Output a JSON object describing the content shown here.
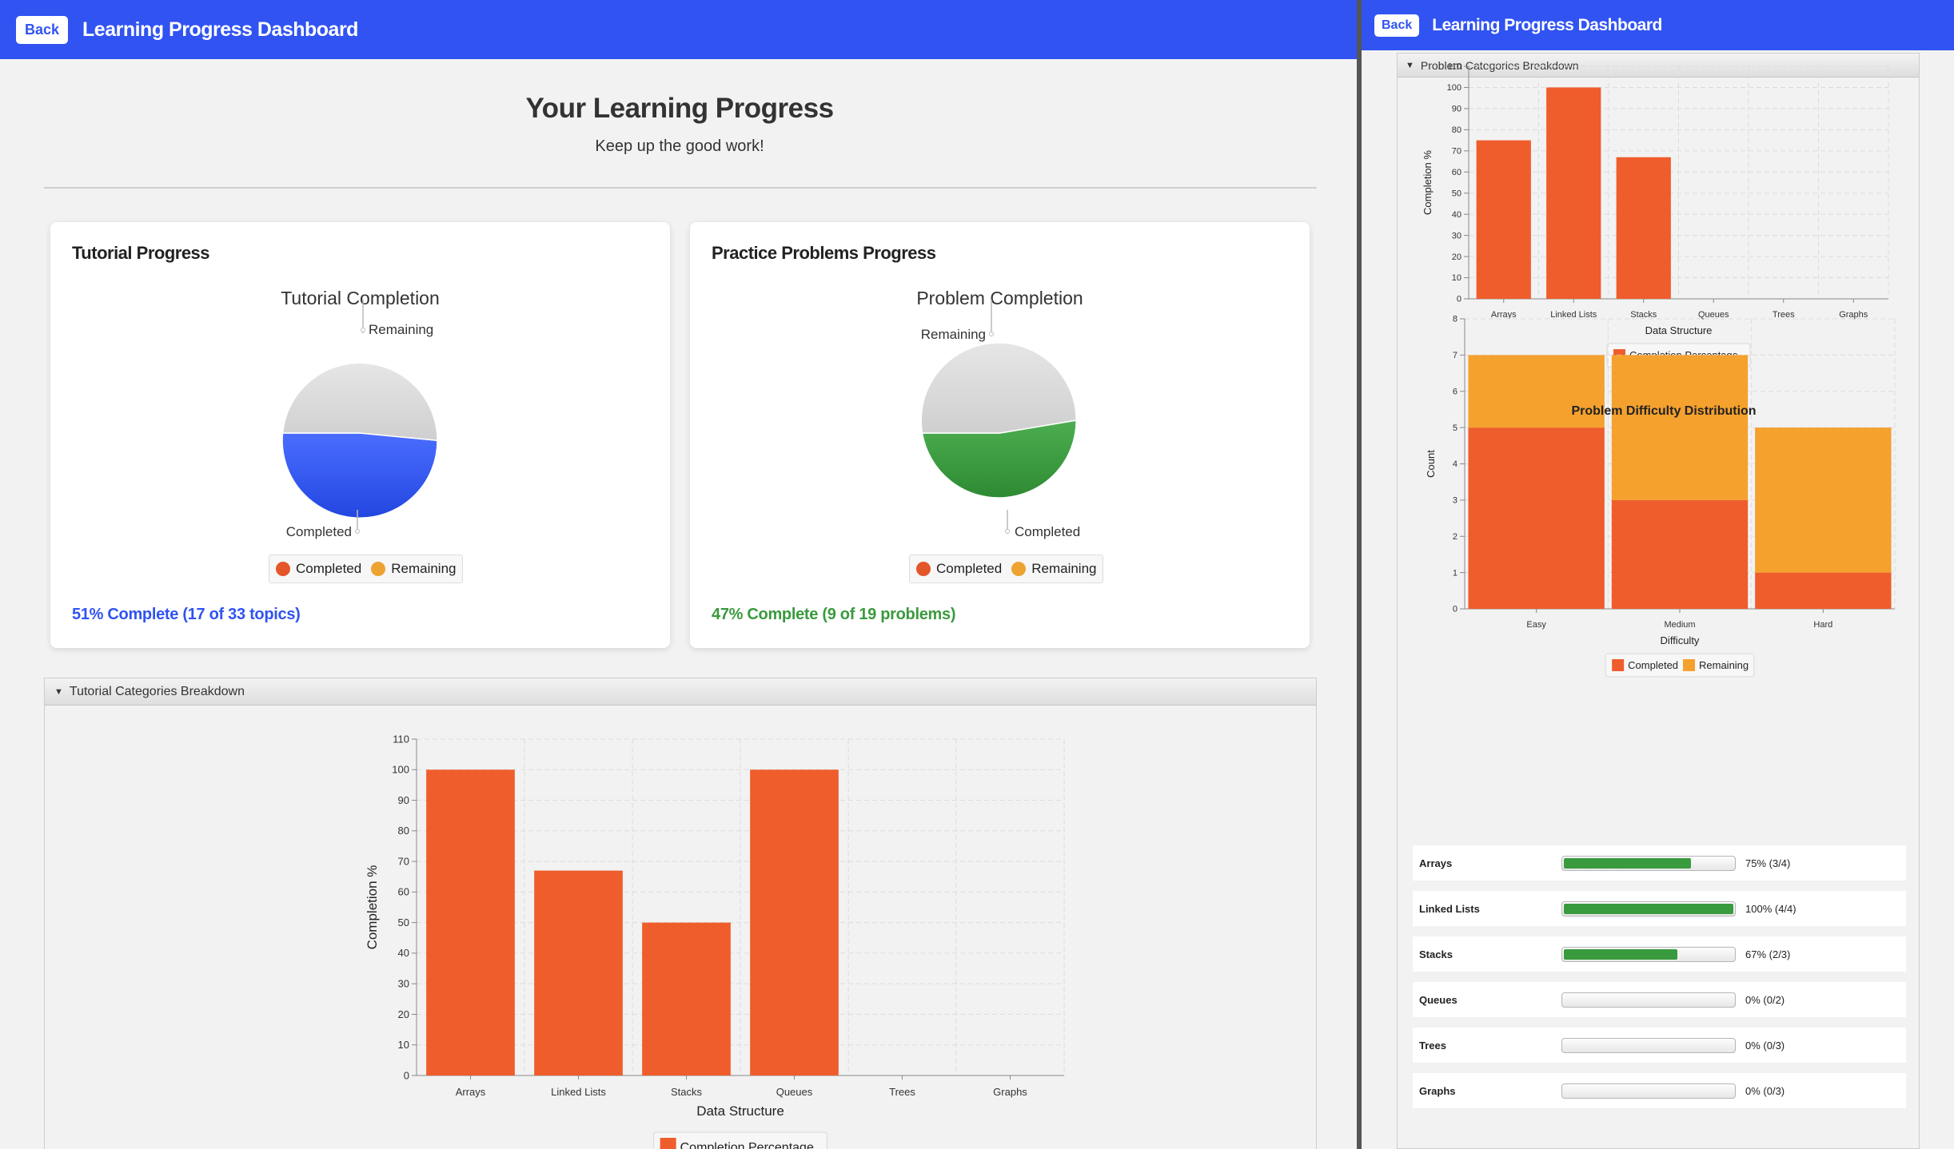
{
  "left_window": {
    "header": {
      "back_label": "Back",
      "title": "Learning Progress Dashboard"
    },
    "page_title": "Your Learning Progress",
    "page_subtitle": "Keep up the good work!",
    "tutorial_card": {
      "title": "Tutorial Progress",
      "pie_title": "Tutorial Completion",
      "label_completed": "Completed",
      "label_remaining": "Remaining",
      "legend": [
        "Completed",
        "Remaining"
      ],
      "summary": "51% Complete (17 of 33 topics)"
    },
    "problems_card": {
      "title": "Practice Problems Progress",
      "pie_title": "Problem Completion",
      "label_completed": "Completed",
      "label_remaining": "Remaining",
      "legend": [
        "Completed",
        "Remaining"
      ],
      "summary": "47% Complete (9 of 19 problems)"
    },
    "tutorial_pane": {
      "title": "Tutorial Categories Breakdown"
    }
  },
  "right_window": {
    "header": {
      "back_label": "Back",
      "title": "Learning Progress Dashboard"
    },
    "problems_pane": {
      "title": "Problem Categories Breakdown"
    },
    "progress_rows": [
      {
        "label": "Arrays",
        "fraction": 0.75,
        "text": "75% (3/4)"
      },
      {
        "label": "Linked Lists",
        "fraction": 1.0,
        "text": "100% (4/4)"
      },
      {
        "label": "Stacks",
        "fraction": 0.67,
        "text": "67% (2/3)"
      },
      {
        "label": "Queues",
        "fraction": 0.0,
        "text": "0% (0/2)"
      },
      {
        "label": "Trees",
        "fraction": 0.0,
        "text": "0% (0/3)"
      },
      {
        "label": "Graphs",
        "fraction": 0.0,
        "text": "0% (0/3)"
      }
    ]
  },
  "colors": {
    "header": "#3053f2",
    "tutorial_completed": "#3053f2",
    "problem_completed": "#3a9a3e",
    "remaining": "#d6d6d6",
    "bar": "#ef5d2c",
    "bar_remaining": "#f5a12e",
    "legend_completed_dot": "#e4552a",
    "legend_remaining_dot": "#eea232",
    "tutorial_text": "#3053f2",
    "problem_text": "#3a9a3e"
  },
  "chart_data": [
    {
      "id": "tutorial_pie",
      "type": "pie",
      "title": "Tutorial Completion",
      "labels": [
        "Completed",
        "Remaining"
      ],
      "values": [
        17,
        16
      ]
    },
    {
      "id": "problem_pie",
      "type": "pie",
      "title": "Problem Completion",
      "labels": [
        "Completed",
        "Remaining"
      ],
      "values": [
        9,
        10
      ]
    },
    {
      "id": "tutorial_bar",
      "type": "bar",
      "categories": [
        "Arrays",
        "Linked Lists",
        "Stacks",
        "Queues",
        "Trees",
        "Graphs"
      ],
      "series": [
        {
          "name": "Completion Percentage",
          "values": [
            100,
            67,
            50,
            100,
            0,
            0
          ]
        }
      ],
      "xlabel": "Data Structure",
      "ylabel": "Completion %",
      "ylim": [
        0,
        110
      ],
      "yticks": [
        0,
        10,
        20,
        30,
        40,
        50,
        60,
        70,
        80,
        90,
        100,
        110
      ],
      "grid": true,
      "legend": "bottom"
    },
    {
      "id": "problem_bar",
      "type": "bar",
      "categories": [
        "Arrays",
        "Linked Lists",
        "Stacks",
        "Queues",
        "Trees",
        "Graphs"
      ],
      "series": [
        {
          "name": "Completion Percentage",
          "values": [
            75,
            100,
            67,
            0,
            0,
            0
          ]
        }
      ],
      "xlabel": "Data Structure",
      "ylabel": "Completion %",
      "ylim": [
        0,
        110
      ],
      "yticks": [
        0,
        10,
        20,
        30,
        40,
        50,
        60,
        70,
        80,
        90,
        100,
        110
      ],
      "grid": true,
      "legend": "bottom"
    },
    {
      "id": "difficulty_bar",
      "type": "bar",
      "stacked": true,
      "title": "Problem Difficulty Distribution",
      "categories": [
        "Easy",
        "Medium",
        "Hard"
      ],
      "series": [
        {
          "name": "Completed",
          "values": [
            5,
            3,
            1
          ]
        },
        {
          "name": "Remaining",
          "values": [
            2,
            4,
            4
          ]
        }
      ],
      "xlabel": "Difficulty",
      "ylabel": "Count",
      "ylim": [
        0,
        8
      ],
      "yticks": [
        0,
        1,
        2,
        3,
        4,
        5,
        6,
        7,
        8
      ],
      "grid": true,
      "legend": "bottom"
    }
  ]
}
